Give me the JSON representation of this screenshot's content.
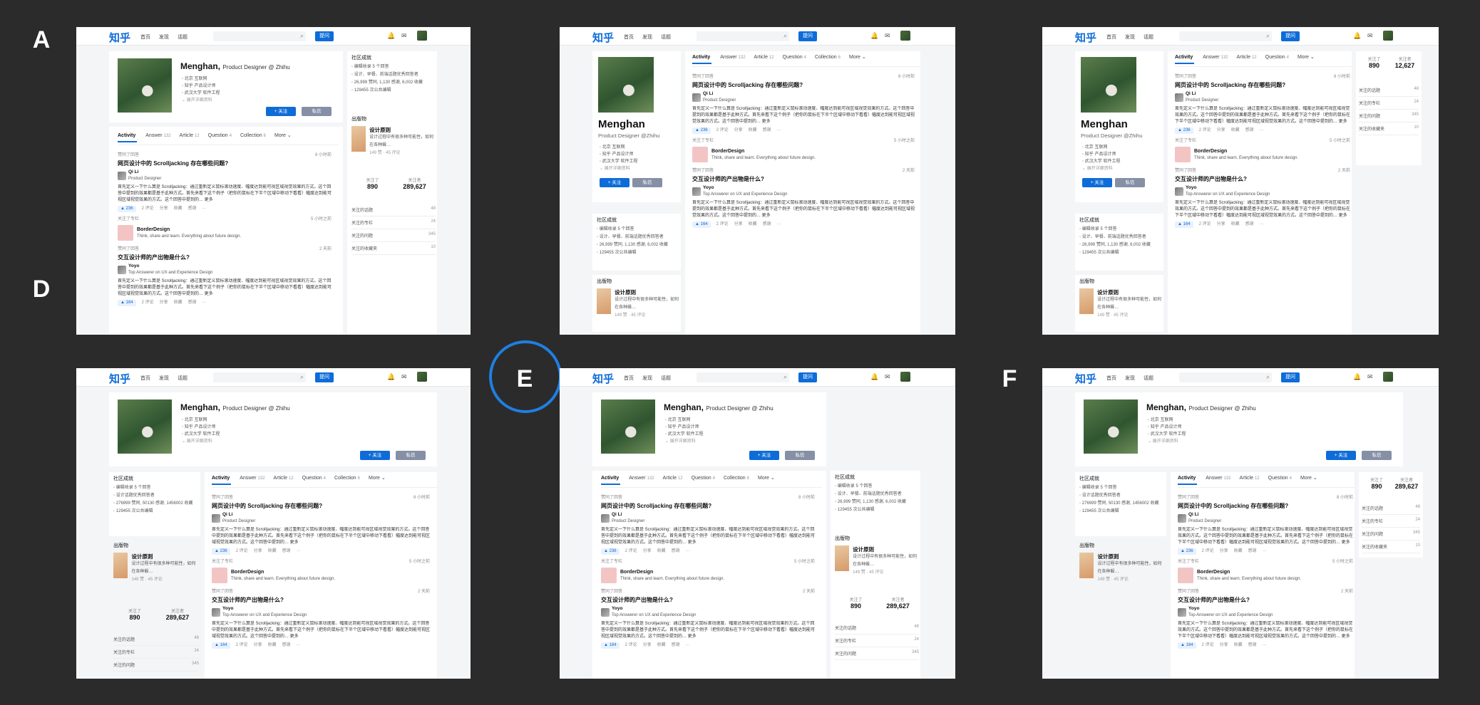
{
  "labels": [
    "A",
    "B",
    "C",
    "D",
    "E",
    "F"
  ],
  "selected": "E",
  "app": {
    "logo": "知乎",
    "nav": [
      "首页",
      "发现",
      "话题"
    ],
    "ask": "提问",
    "search_icon": "search-icon",
    "bell_icon": "bell-icon",
    "message_icon": "message-icon"
  },
  "profile": {
    "name": "Menghan",
    "title_inline": "Product Designer @ Zhihu",
    "title_block": "Product Designer @Zhihu",
    "info": [
      "北京  互联网",
      "知乎  产品设计师",
      "武汉大学  软件工程"
    ],
    "more_info": "展开详细资料",
    "follow": "+ 关注",
    "message": "私信"
  },
  "tabs": [
    {
      "label": "Activity",
      "count": ""
    },
    {
      "label": "Answer",
      "count": "132"
    },
    {
      "label": "Article",
      "count": "12"
    },
    {
      "label": "Question",
      "count": "4"
    },
    {
      "label": "Collection",
      "count": "6"
    },
    {
      "label": "More",
      "count": ""
    }
  ],
  "feed": [
    {
      "type": "answer",
      "verb": "赞同了回答",
      "time": "8 小时前",
      "question": "网页设计中的 Scrolljacking 存在哪些问题?",
      "author": "Qi Li",
      "author_desc": "Product Designer",
      "body": "首先定义一下什么算是 Scrolljacking：通过重新定义鼠标滚动速度、幅度达到能可视区域视觉效果的方式。这个回答中提到的效果都是基于此种方式。首先来看下这个例子（把你的鼠标在下半个区域中移动下看看）幅度达到能可视区域视觉效果的方式。这个回答中提到的… 更多",
      "votes": "▲ 236",
      "actions": [
        "2 评论",
        "分享",
        "收藏",
        "感谢",
        "···"
      ]
    },
    {
      "type": "column",
      "verb": "关注了专栏",
      "time": "5 小时之前",
      "name": "BorderDesign",
      "desc": "Think, share and learn. Everything about future design."
    },
    {
      "type": "answer",
      "verb": "赞同了回答",
      "time": "2 天前",
      "question": "交互设计师的产出物是什么?",
      "author": "Yoyo",
      "author_desc": "Top Answerer on UX and Experience Design",
      "body": "首先定义一下什么算是 Scrolljacking：通过重新定义鼠标滚动速度、幅度达到能可视区域视觉效果的方式。这个回答中提到的效果都是基于此种方式。首先来看下这个例子（把你的鼠标在下半个区域中移动下看看）幅度达到能可视区域视觉效果的方式。这个回答中提到的… 更多",
      "votes": "▲ 164",
      "actions": [
        "2 评论",
        "分享",
        "收藏",
        "感谢",
        "···"
      ]
    }
  ],
  "community": {
    "title": "社区成就",
    "items": [
      "编辑收录 5 个回答",
      "设计、早餐、前端话题优秀回答者",
      "26,999 赞同, 1,130 感谢, 6,002 收藏",
      "129455 次公共编辑"
    ],
    "items_d": [
      "编辑收录 5 个回答",
      "设计话题优秀回答者",
      "276999 赞同, 50130 感谢, 1456002 收藏",
      "129455 次公共编辑"
    ]
  },
  "publication": {
    "title": "出版物",
    "book": "设计原则",
    "desc": "设计过程中有很多种可能性，如何在各种躲…",
    "meta": "149 赞 · 45 评论"
  },
  "stats": {
    "following_label": "关注了",
    "following": "890",
    "followers_label": "关注者",
    "followers": "289,627",
    "followers_c": "12,627"
  },
  "side_list": [
    {
      "label": "关注的话题",
      "value": "48"
    },
    {
      "label": "关注的专栏",
      "value": "24"
    },
    {
      "label": "关注的问题",
      "value": "345"
    },
    {
      "label": "关注的收藏夹",
      "value": "10"
    }
  ]
}
